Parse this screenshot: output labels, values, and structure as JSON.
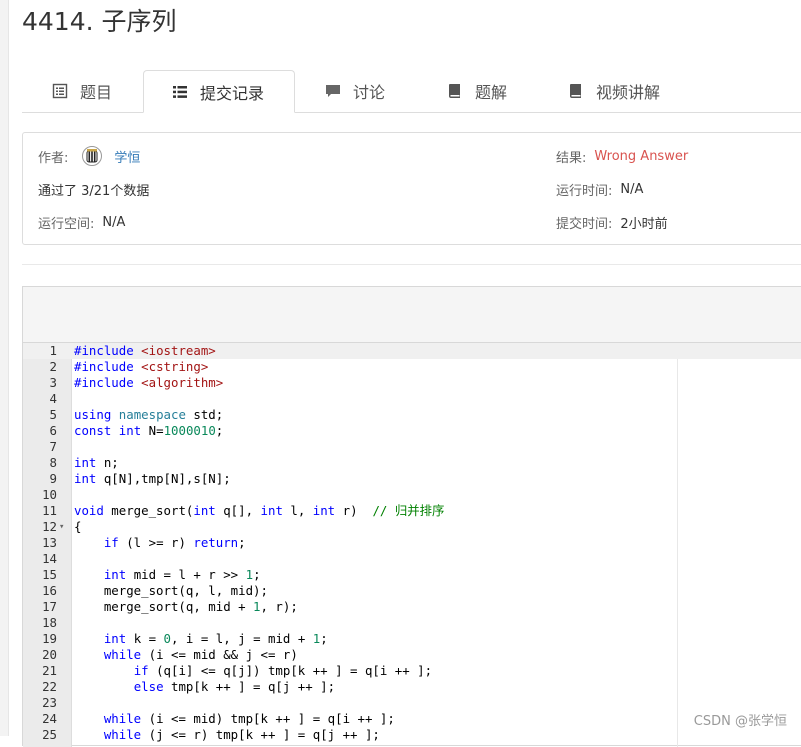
{
  "problem": {
    "title": "4414. 子序列"
  },
  "tabs": [
    {
      "label": "题目",
      "icon": "list-square-icon",
      "active": false
    },
    {
      "label": "提交记录",
      "icon": "list-icon",
      "active": true
    },
    {
      "label": "讨论",
      "icon": "comment-icon",
      "active": false
    },
    {
      "label": "题解",
      "icon": "book-icon",
      "active": false
    },
    {
      "label": "视频讲解",
      "icon": "book-icon",
      "active": false
    }
  ],
  "submission": {
    "author_label": "作者:",
    "author_name": "学恒",
    "passed": "通过了 3/21个数据",
    "memory_label": "运行空间:",
    "memory_value": "N/A",
    "result_label": "结果:",
    "result_value": "Wrong Answer",
    "time_label": "运行时间:",
    "time_value": "N/A",
    "submit_time_label": "提交时间:",
    "submit_time_value": "2小时前"
  },
  "colors": {
    "result_error": "#d9534f",
    "link": "#337ab7"
  },
  "code": {
    "lines": [
      [
        [
          "kw",
          "#include"
        ],
        [
          "",
          " "
        ],
        [
          "str",
          "<iostream>"
        ]
      ],
      [
        [
          "kw",
          "#include"
        ],
        [
          "",
          " "
        ],
        [
          "str",
          "<cstring>"
        ]
      ],
      [
        [
          "kw",
          "#include"
        ],
        [
          "",
          " "
        ],
        [
          "str",
          "<algorithm>"
        ]
      ],
      [],
      [
        [
          "kw",
          "using"
        ],
        [
          "",
          " "
        ],
        [
          "ns",
          "namespace"
        ],
        [
          "",
          " std;"
        ]
      ],
      [
        [
          "kw",
          "const"
        ],
        [
          "",
          " "
        ],
        [
          "kw",
          "int"
        ],
        [
          "",
          " N="
        ],
        [
          "num",
          "1000010"
        ],
        [
          "",
          ";"
        ]
      ],
      [],
      [
        [
          "kw",
          "int"
        ],
        [
          "",
          " n;"
        ]
      ],
      [
        [
          "kw",
          "int"
        ],
        [
          "",
          " q[N],tmp[N],s[N];"
        ]
      ],
      [],
      [
        [
          "kw",
          "void"
        ],
        [
          "",
          " merge_sort("
        ],
        [
          "kw",
          "int"
        ],
        [
          "",
          " q[], "
        ],
        [
          "kw",
          "int"
        ],
        [
          "",
          " l, "
        ],
        [
          "kw",
          "int"
        ],
        [
          "",
          " r)  "
        ],
        [
          "cm",
          "// 归并排序"
        ]
      ],
      [
        [
          "",
          "{"
        ]
      ],
      [
        [
          "",
          "    "
        ],
        [
          "kw",
          "if"
        ],
        [
          "",
          " (l >= r) "
        ],
        [
          "kw",
          "return"
        ],
        [
          "",
          ";"
        ]
      ],
      [],
      [
        [
          "",
          "    "
        ],
        [
          "kw",
          "int"
        ],
        [
          "",
          " mid = l + r >> "
        ],
        [
          "num",
          "1"
        ],
        [
          "",
          ";"
        ]
      ],
      [
        [
          "",
          "    merge_sort(q, l, mid);"
        ]
      ],
      [
        [
          "",
          "    merge_sort(q, mid + "
        ],
        [
          "num",
          "1"
        ],
        [
          "",
          ", r);"
        ]
      ],
      [],
      [
        [
          "",
          "    "
        ],
        [
          "kw",
          "int"
        ],
        [
          "",
          " k = "
        ],
        [
          "num",
          "0"
        ],
        [
          "",
          ", i = l, j = mid + "
        ],
        [
          "num",
          "1"
        ],
        [
          "",
          ";"
        ]
      ],
      [
        [
          "",
          "    "
        ],
        [
          "kw",
          "while"
        ],
        [
          "",
          " (i <= mid && j <= r)"
        ]
      ],
      [
        [
          "",
          "        "
        ],
        [
          "kw",
          "if"
        ],
        [
          "",
          " (q[i] <= q[j]) tmp[k ++ ] = q[i ++ ];"
        ]
      ],
      [
        [
          "",
          "        "
        ],
        [
          "kw",
          "else"
        ],
        [
          "",
          " tmp[k ++ ] = q[j ++ ];"
        ]
      ],
      [],
      [
        [
          "",
          "    "
        ],
        [
          "kw",
          "while"
        ],
        [
          "",
          " (i <= mid) tmp[k ++ ] = q[i ++ ];"
        ]
      ],
      [
        [
          "",
          "    "
        ],
        [
          "kw",
          "while"
        ],
        [
          "",
          " (j <= r) tmp[k ++ ] = q[j ++ ];"
        ]
      ]
    ],
    "fold_line": 12,
    "active_line": 1
  },
  "watermark": "CSDN @张学恒"
}
